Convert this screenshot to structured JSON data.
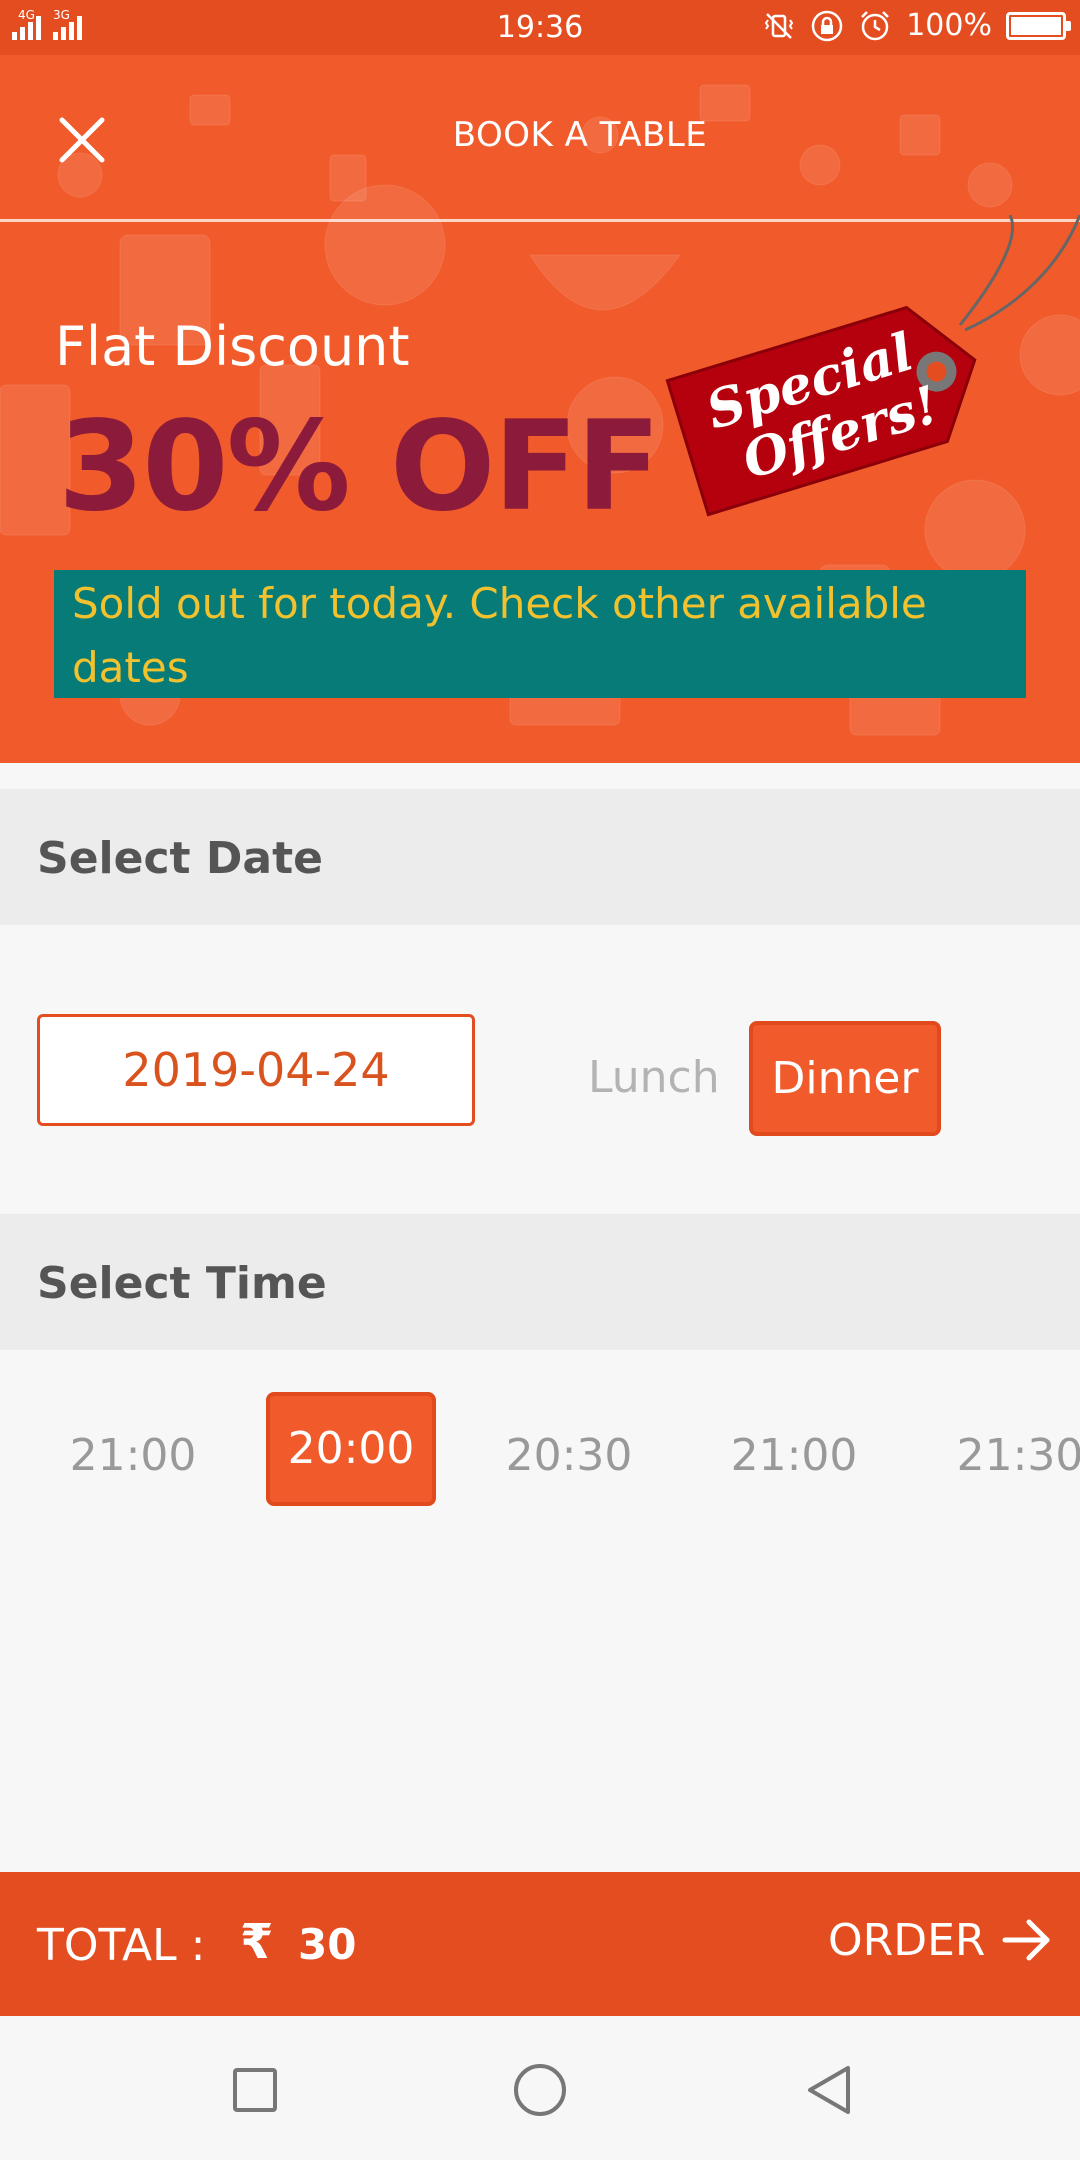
{
  "status_bar": {
    "network_left": "4G",
    "network_right": "3G",
    "time": "19:36",
    "battery": "100%"
  },
  "header": {
    "title": "BOOK A TABLE"
  },
  "banner": {
    "flat_label": "Flat Discount",
    "offer": "30% OFF",
    "tag_line1": "Special",
    "tag_line2": "Offers!",
    "sold_out_message": "Sold out for today. Check other available dates"
  },
  "date_section": {
    "heading": "Select Date",
    "date_value": "2019-04-24",
    "meal_options": [
      "Lunch",
      "Dinner"
    ],
    "selected_meal": "Dinner"
  },
  "time_section": {
    "heading": "Select Time",
    "slots": [
      "21:00",
      "20:00",
      "20:30",
      "21:00",
      "21:30"
    ],
    "selected_slot": "20:00"
  },
  "order_bar": {
    "total_label": "TOTAL :",
    "currency_symbol": "₹",
    "amount": "30",
    "order_label": "ORDER"
  },
  "colors": {
    "primary": "#f15a2b",
    "primary_dark": "#e44d20",
    "offer_text": "#8c1a3a",
    "notice_bg": "#067b78",
    "notice_text": "#f2c12e",
    "tag_red": "#b5000e"
  },
  "icons": {
    "close": "close-icon",
    "order_arrow": "arrow-right-icon",
    "nav_recent": "square-icon",
    "nav_home": "circle-icon",
    "nav_back": "triangle-back-icon"
  }
}
